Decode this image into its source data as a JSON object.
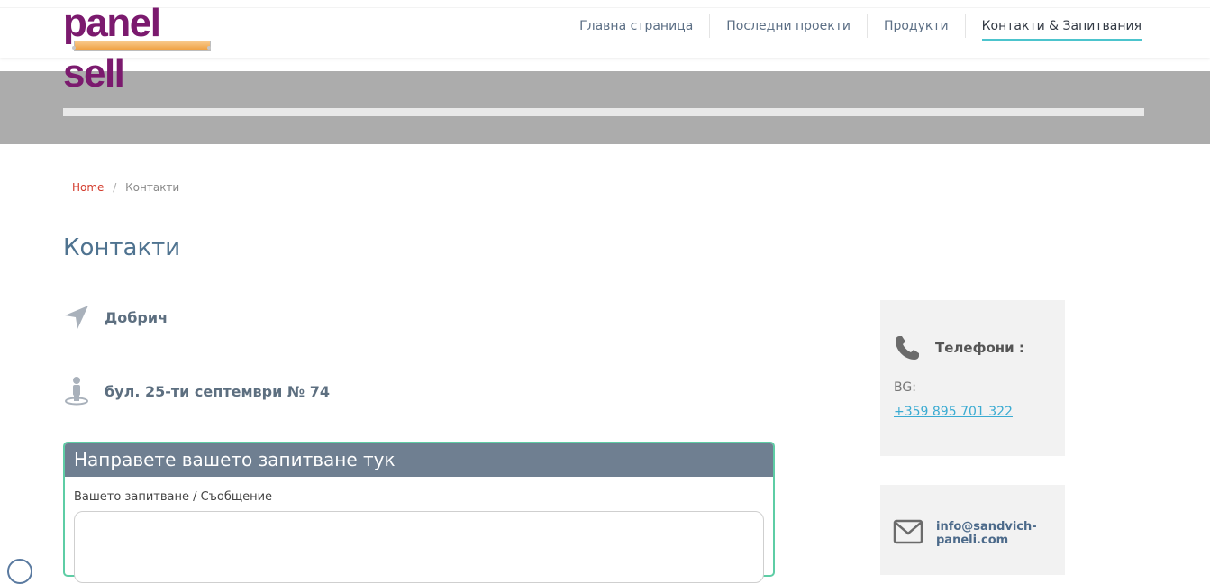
{
  "brand": {
    "logo_text": "panel sell",
    "logo_color": "#7b1a6e"
  },
  "nav": {
    "items": [
      {
        "label": "Главна страница"
      },
      {
        "label": "Последни проекти"
      },
      {
        "label": "Продукти"
      },
      {
        "label": "Контакти & Запитвания"
      }
    ],
    "active_index": 3,
    "active_underline_color": "#4cc4cd"
  },
  "breadcrumb": {
    "home": "Home",
    "separator": "/",
    "current": "Контакти"
  },
  "page": {
    "title": "Контакти"
  },
  "contact": {
    "city": "Добрич",
    "address": "бул. 25-ти септември № 74",
    "city_icon": "location-arrow-icon",
    "address_icon": "street-view-icon"
  },
  "form": {
    "heading": "Направете вашето запитване тук",
    "message_label": "Вашето запитване / Съобщение",
    "border_color": "#5ecda5",
    "header_color": "#6f7f91"
  },
  "sidebar": {
    "phones": {
      "title": "Телефони :",
      "label": "BG:",
      "phone": "+359 895 701 322",
      "icon": "phone-icon"
    },
    "email": {
      "address": "info@sandvich-paneli.com",
      "icon": "envelope-icon"
    }
  }
}
